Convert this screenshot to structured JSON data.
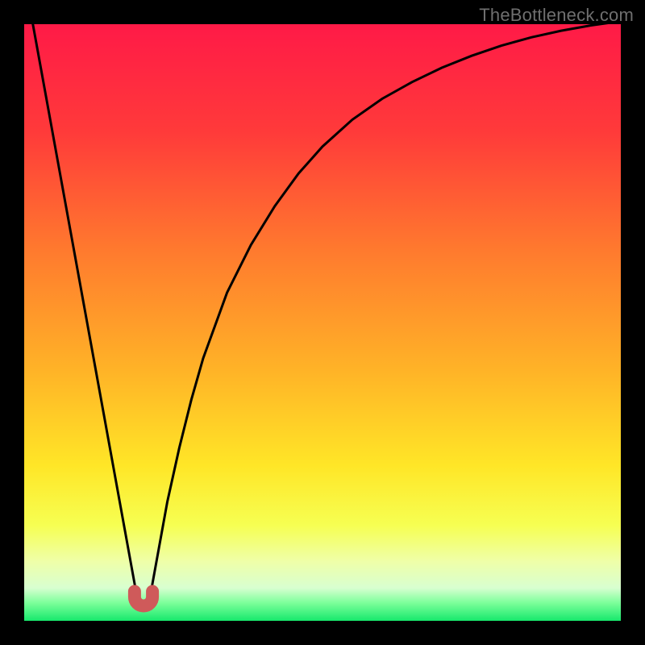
{
  "watermark": "TheBottleneck.com",
  "chart_data": {
    "type": "line",
    "title": "",
    "xlabel": "",
    "ylabel": "",
    "xlim": [
      0,
      100
    ],
    "ylim": [
      0,
      100
    ],
    "grid": false,
    "annotations": [],
    "series": [
      {
        "name": "bottleneck-curve",
        "x": [
          0,
          2,
          4,
          6,
          8,
          10,
          12,
          14,
          16,
          18,
          19,
          20,
          21,
          22,
          24,
          26,
          28,
          30,
          34,
          38,
          42,
          46,
          50,
          55,
          60,
          65,
          70,
          75,
          80,
          85,
          90,
          95,
          100
        ],
        "y": [
          108,
          97,
          86,
          75,
          64,
          53,
          42,
          31,
          20,
          9,
          3.5,
          2.5,
          3.5,
          9,
          20,
          29,
          37,
          44,
          55,
          63,
          69.5,
          75,
          79.5,
          84,
          87.5,
          90.3,
          92.7,
          94.7,
          96.4,
          97.8,
          98.9,
          99.8,
          100.5
        ]
      }
    ],
    "marker": {
      "name": "minimum-u-marker",
      "x_range": [
        18.5,
        21.5
      ],
      "y": 2.5,
      "color": "#cf5a5a"
    },
    "gradient_stops": [
      {
        "pos": 0.0,
        "color": "#ff1a47"
      },
      {
        "pos": 0.18,
        "color": "#ff3a3a"
      },
      {
        "pos": 0.38,
        "color": "#ff7a2e"
      },
      {
        "pos": 0.58,
        "color": "#ffb327"
      },
      {
        "pos": 0.74,
        "color": "#ffe627"
      },
      {
        "pos": 0.84,
        "color": "#f6ff52"
      },
      {
        "pos": 0.9,
        "color": "#efffa8"
      },
      {
        "pos": 0.945,
        "color": "#d8ffd0"
      },
      {
        "pos": 0.97,
        "color": "#7cff9a"
      },
      {
        "pos": 1.0,
        "color": "#17e86c"
      }
    ]
  }
}
